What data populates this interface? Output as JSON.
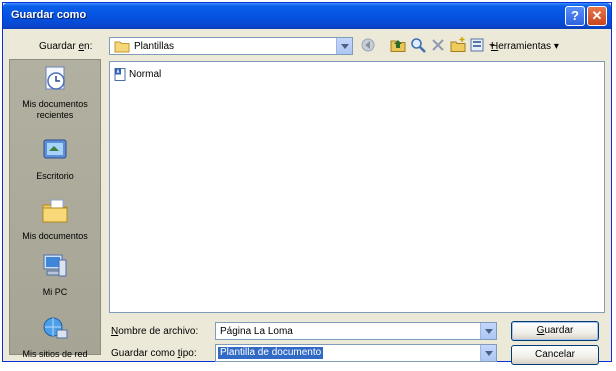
{
  "window": {
    "title": "Guardar como"
  },
  "top": {
    "save_in_label_pre": "Guardar ",
    "save_in_label_key": "e",
    "save_in_label_post": "n:",
    "location": "Plantillas",
    "tools_label_key": "H",
    "tools_label_rest": "erramientas",
    "tools_arrow": "▾"
  },
  "places": [
    {
      "label": "Mis documentos recientes",
      "icon": "recent-documents-icon"
    },
    {
      "label": "Escritorio",
      "icon": "desktop-icon"
    },
    {
      "label": "Mis documentos",
      "icon": "my-documents-icon"
    },
    {
      "label": "Mi PC",
      "icon": "my-computer-icon"
    },
    {
      "label": "Mis sitios de red",
      "icon": "network-places-icon"
    }
  ],
  "files": [
    {
      "name": "Normal",
      "icon": "word-document-icon"
    }
  ],
  "bottom": {
    "filename_label_key": "N",
    "filename_label_rest": "ombre de archivo:",
    "filename_value": "Página La Loma",
    "filetype_label_pre": "Guardar como ",
    "filetype_label_key": "t",
    "filetype_label_post": "ipo:",
    "filetype_value": "Plantilla de documento"
  },
  "buttons": {
    "save_key": "G",
    "save_rest": "uardar",
    "cancel": "Cancelar"
  },
  "colors": {
    "titlebar": "#0553E3",
    "dialog_bg": "#ECE9D8",
    "selection": "#316AC5"
  }
}
